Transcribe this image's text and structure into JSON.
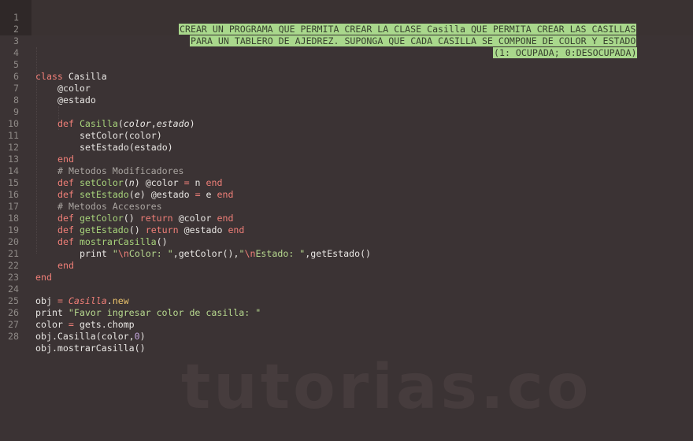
{
  "editor": {
    "comment_header": [
      "CREAR UN PROGRAMA QUE PERMITA CREAR LA CLASE Casilla QUE PERMITA CREAR LAS CASILLAS",
      "PARA UN TABLERO DE AJEDREZ. SUPONGA QUE CADA CASILLA SE COMPONE DE COLOR Y ESTADO",
      "(1: OCUPADA; 0:DESOCUPADA)"
    ],
    "line_numbers": [
      "1",
      "2",
      "3",
      "4",
      "5",
      "6",
      "7",
      "8",
      "9",
      "10",
      "11",
      "12",
      "13",
      "14",
      "15",
      "16",
      "17",
      "18",
      "19",
      "20",
      "21",
      "22",
      "23",
      "24",
      "25",
      "26",
      "27",
      "28"
    ],
    "tokens": {
      "class_kw": "class",
      "class_name": "Casilla",
      "ivar_color": "@color",
      "ivar_estado": "@estado",
      "def_kw": "def",
      "end_kw": "end",
      "return_kw": "return",
      "ctor_name": "Casilla",
      "ctor_param1": "color",
      "ctor_param2": "estado",
      "call_set_color": "setColor(color)",
      "call_set_estado": "setEstado(estado)",
      "comment_modificadores": "# Metodos Modificadores",
      "comment_accesores": "# Metodos Accesores",
      "fn_set_color": "setColor",
      "fn_set_estado": "setEstado",
      "fn_get_color": "getColor",
      "fn_get_estado": "getEstado",
      "fn_mostrar": "mostrarCasilla",
      "param_n": "n",
      "param_e": "e",
      "print_kw": "print",
      "str_color_esc": "\\n",
      "str_color_text": "Color: ",
      "str_estado_esc": "\\n",
      "str_estado_text": "Estado: ",
      "call_get_color": "getColor()",
      "call_get_estado": "getEstado()",
      "obj_var": "obj",
      "new_method": "new",
      "prompt_string": "\"Favor ingresar color de casilla: \"",
      "color_var": "color",
      "gets_chomp": "gets.chomp",
      "obj_casilla_call": "obj.Casilla(color,",
      "zero_arg": "0",
      "obj_mostrar_call": "obj.mostrarCasilla()"
    }
  },
  "watermark": "tutorias.co"
}
